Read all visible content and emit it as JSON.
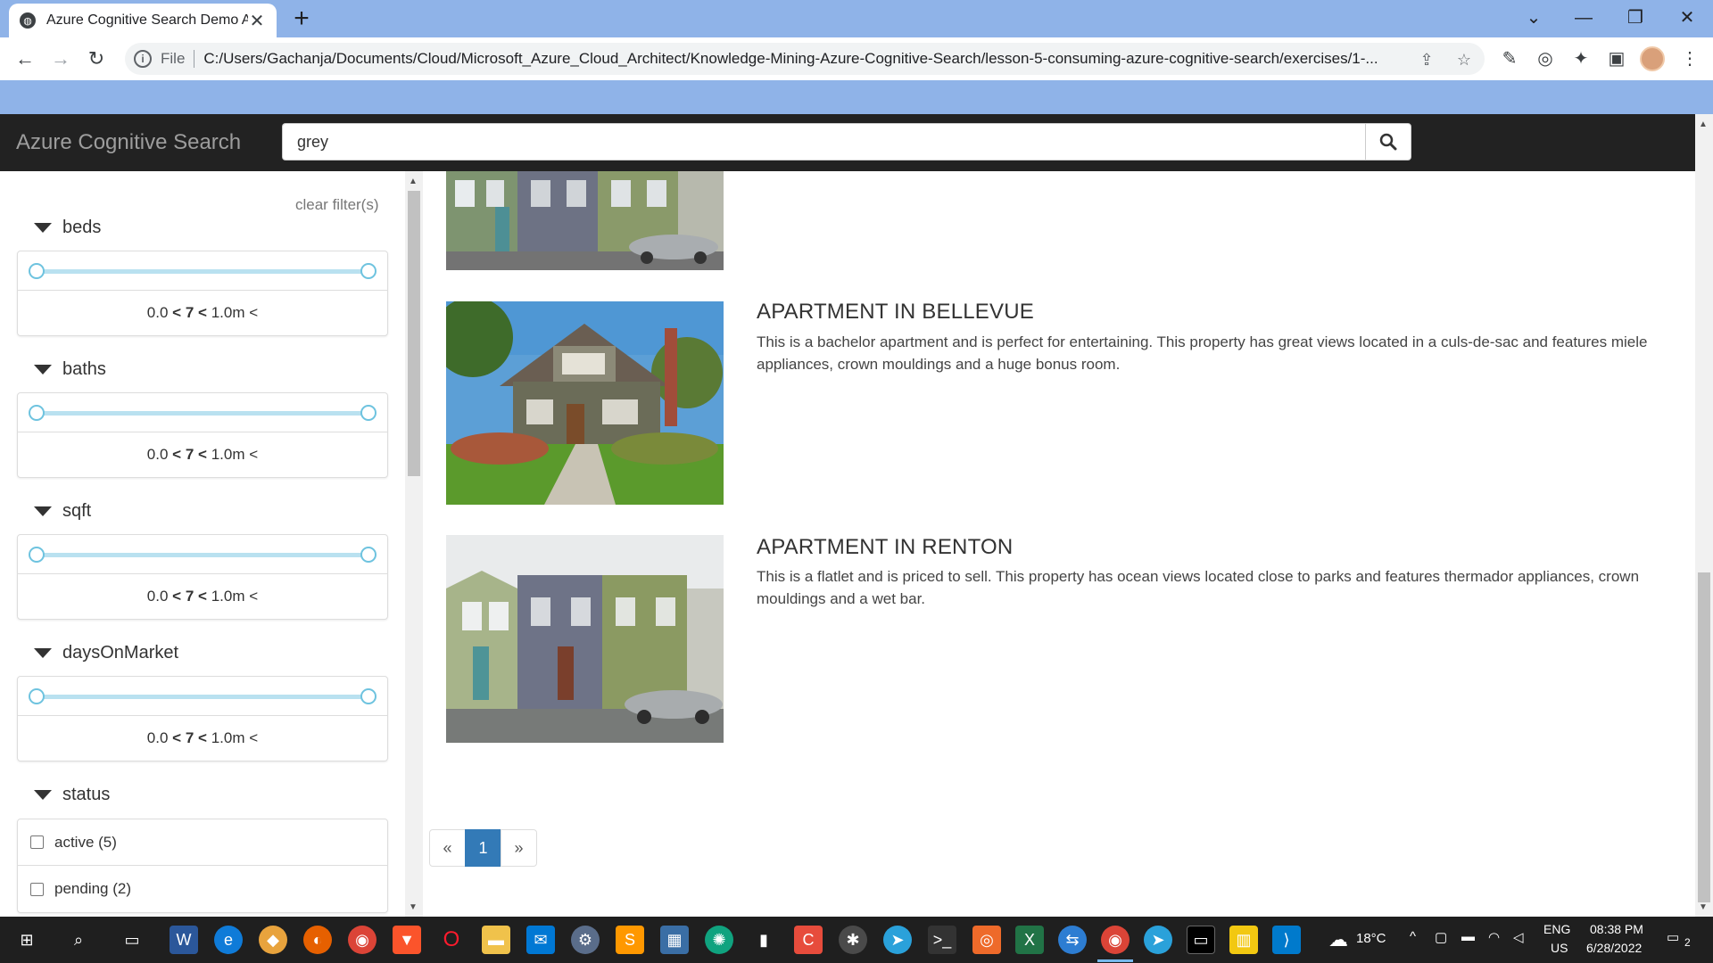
{
  "browser": {
    "tab_title": "Azure Cognitive Search Demo Ap",
    "url_scheme": "File",
    "url": "C:/Users/Gachanja/Documents/Cloud/Microsoft_Azure_Cloud_Architect/Knowledge-Mining-Azure-Cognitive-Search/lesson-5-consuming-azure-cognitive-search/exercises/1-..."
  },
  "app": {
    "brand": "Azure Cognitive Search",
    "search_value": "grey"
  },
  "sidebar": {
    "clear_filters": "clear filter(s)",
    "range_facets": [
      {
        "title": "beds",
        "min": "0.0",
        "sep1": "<",
        "mid": "7",
        "sep2": "<",
        "max": "1.0m",
        "sep3": "<"
      },
      {
        "title": "baths",
        "min": "0.0",
        "sep1": "<",
        "mid": "7",
        "sep2": "<",
        "max": "1.0m",
        "sep3": "<"
      },
      {
        "title": "sqft",
        "min": "0.0",
        "sep1": "<",
        "mid": "7",
        "sep2": "<",
        "max": "1.0m",
        "sep3": "<"
      },
      {
        "title": "daysOnMarket",
        "min": "0.0",
        "sep1": "<",
        "mid": "7",
        "sep2": "<",
        "max": "1.0m",
        "sep3": "<"
      }
    ],
    "status": {
      "title": "status",
      "options": [
        "active (5)",
        "pending (2)"
      ]
    }
  },
  "results": [
    {
      "title": "APARTMENT IN BELLEVUE",
      "description": "This is a bachelor apartment and is perfect for entertaining. This property has great views located in a culs-de-sac and features miele appliances, crown mouldings and a huge bonus room."
    },
    {
      "title": "APARTMENT IN RENTON",
      "description": "This is a flatlet and is priced to sell. This property has ocean views located close to parks and features thermador appliances, crown mouldings and a wet bar."
    }
  ],
  "pagination": {
    "prev": "«",
    "current": "1",
    "next": "»"
  },
  "taskbar": {
    "weather": "18°C",
    "lang_top": "ENG",
    "lang_bottom": "US",
    "time": "08:38 PM",
    "date": "6/28/2022",
    "notifications": "2"
  },
  "colors": {
    "tabstrip": "#8fb3e8",
    "navbar": "#222222",
    "pager_active": "#337ab7",
    "slider_track": "#b9e1f0"
  }
}
